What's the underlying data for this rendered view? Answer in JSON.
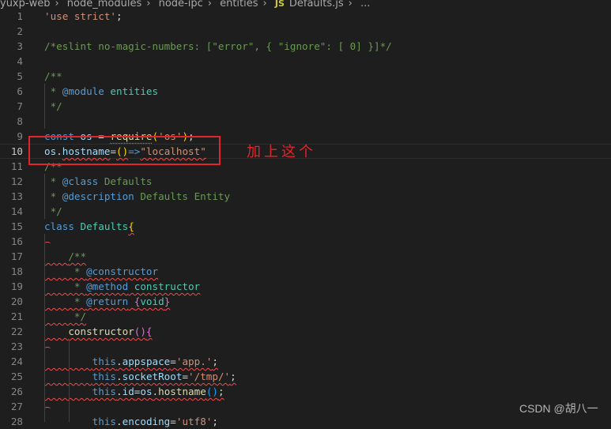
{
  "breadcrumb": {
    "items": [
      "yuxp-web",
      "node_modules",
      "node-ipc",
      "entities"
    ],
    "file_icon": "JS",
    "file": "Defaults.js",
    "more": "..."
  },
  "annotation": {
    "note": "加上这个"
  },
  "watermark": "CSDN @胡八一",
  "current_line": 10,
  "lines": [
    {
      "n": "1",
      "tokens": [
        [
          "'use strict'",
          "s"
        ],
        [
          ";",
          "w"
        ]
      ]
    },
    {
      "n": "2",
      "tokens": []
    },
    {
      "n": "3",
      "tokens": [
        [
          "/*eslint no-magic-numbers: [\"error\", { \"ignore\": [ 0] }]*/",
          "c"
        ]
      ]
    },
    {
      "n": "4",
      "tokens": []
    },
    {
      "n": "5",
      "tokens": [
        [
          "/**",
          "c"
        ]
      ]
    },
    {
      "n": "6",
      "tokens": [
        [
          " * ",
          "c"
        ],
        [
          "@module",
          "tag"
        ],
        [
          " entities",
          "t"
        ]
      ]
    },
    {
      "n": "7",
      "tokens": [
        [
          " */",
          "c"
        ]
      ]
    },
    {
      "n": "8",
      "tokens": []
    },
    {
      "n": "9",
      "tokens": [
        [
          "const",
          "k"
        ],
        [
          " ",
          "w"
        ],
        [
          "os",
          "v"
        ],
        [
          " = ",
          "w"
        ],
        [
          "require",
          "f dot"
        ],
        [
          "(",
          "y"
        ],
        [
          "'os'",
          "s"
        ],
        [
          ")",
          "y"
        ],
        [
          ";",
          "w"
        ]
      ]
    },
    {
      "n": "10",
      "tokens": [
        [
          "os",
          "v"
        ],
        [
          ".",
          "w"
        ],
        [
          "hostname",
          "v sq"
        ],
        [
          "=",
          "w"
        ],
        [
          "()",
          "y sq"
        ],
        [
          "=>",
          "k"
        ],
        [
          "\"localhost\"",
          "s sq"
        ]
      ]
    },
    {
      "n": "11",
      "tokens": [
        [
          "/**",
          "c"
        ]
      ]
    },
    {
      "n": "12",
      "tokens": [
        [
          " * ",
          "c"
        ],
        [
          "@class",
          "tag"
        ],
        [
          " Defaults",
          "c"
        ]
      ]
    },
    {
      "n": "13",
      "tokens": [
        [
          " * ",
          "c"
        ],
        [
          "@description",
          "tag"
        ],
        [
          " Defaults Entity",
          "c"
        ]
      ]
    },
    {
      "n": "14",
      "tokens": [
        [
          " */",
          "c"
        ]
      ]
    },
    {
      "n": "15",
      "tokens": [
        [
          "class",
          "k"
        ],
        [
          " ",
          "w"
        ],
        [
          "Defaults",
          "t"
        ],
        [
          "{",
          "y sq"
        ]
      ]
    },
    {
      "n": "16",
      "tokens": [],
      "caret": true
    },
    {
      "n": "17",
      "tokens": [
        [
          "    ",
          "w sq"
        ],
        [
          "/**",
          "c sq"
        ]
      ]
    },
    {
      "n": "18",
      "tokens": [
        [
          "     * ",
          "c sq"
        ],
        [
          "@constructor",
          "tag sq"
        ]
      ]
    },
    {
      "n": "19",
      "tokens": [
        [
          "     * ",
          "c sq"
        ],
        [
          "@method",
          "tag sq"
        ],
        [
          " constructor",
          "t sq"
        ]
      ]
    },
    {
      "n": "20",
      "tokens": [
        [
          "     * ",
          "c sq"
        ],
        [
          "@return",
          "tag sq"
        ],
        [
          " ",
          "c sq"
        ],
        [
          "{",
          "p sq"
        ],
        [
          "void",
          "t sq"
        ],
        [
          "}",
          "p sq"
        ]
      ]
    },
    {
      "n": "21",
      "tokens": [
        [
          "     */",
          "c sq"
        ]
      ]
    },
    {
      "n": "22",
      "tokens": [
        [
          "    ",
          "w sq"
        ],
        [
          "constructor",
          "f sq"
        ],
        [
          "()",
          "p sq"
        ],
        [
          "{",
          "p sq"
        ]
      ]
    },
    {
      "n": "23",
      "tokens": [],
      "caret": true
    },
    {
      "n": "24",
      "tokens": [
        [
          "        ",
          "w sq"
        ],
        [
          "this",
          "k sq"
        ],
        [
          ".",
          "w sq"
        ],
        [
          "appspace",
          "v sq"
        ],
        [
          "=",
          "w sq"
        ],
        [
          "'app.'",
          "s sq"
        ],
        [
          ";",
          "w sq"
        ]
      ]
    },
    {
      "n": "25",
      "tokens": [
        [
          "        ",
          "w sq"
        ],
        [
          "this",
          "k sq"
        ],
        [
          ".",
          "w sq"
        ],
        [
          "socketRoot",
          "v sq"
        ],
        [
          "=",
          "w sq"
        ],
        [
          "'/tmp/'",
          "s sq"
        ],
        [
          ";",
          "w sq"
        ]
      ]
    },
    {
      "n": "26",
      "tokens": [
        [
          "        ",
          "w sq"
        ],
        [
          "this",
          "k sq"
        ],
        [
          ".",
          "w sq"
        ],
        [
          "id",
          "v sq"
        ],
        [
          "=",
          "w sq"
        ],
        [
          "os",
          "v sq"
        ],
        [
          ".",
          "w sq"
        ],
        [
          "hostname",
          "f sq"
        ],
        [
          "()",
          "b sq"
        ],
        [
          ";",
          "w sq"
        ]
      ]
    },
    {
      "n": "27",
      "tokens": [],
      "caret": true
    },
    {
      "n": "28",
      "tokens": [
        [
          "        ",
          "w"
        ],
        [
          "this",
          "k"
        ],
        [
          ".",
          "w"
        ],
        [
          "encoding",
          "v"
        ],
        [
          "=",
          "w"
        ],
        [
          "'utf8'",
          "s"
        ],
        [
          ";",
          "w"
        ]
      ]
    }
  ]
}
